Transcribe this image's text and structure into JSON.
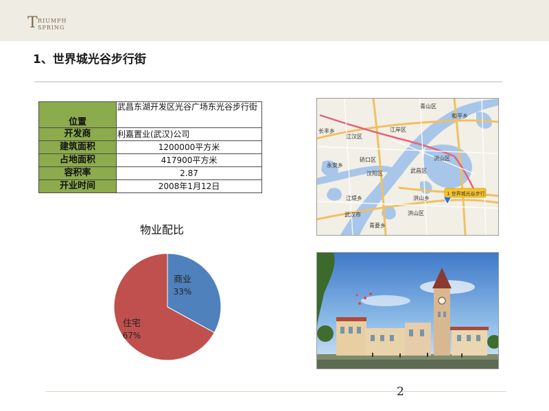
{
  "logo": {
    "letter": "T",
    "line1": "RIUMPH",
    "line2": "SPRING"
  },
  "title": "1、世界城光谷步行街",
  "table": [
    {
      "key": "位置",
      "value": "武昌东湖开发区光谷广场东光谷步行街"
    },
    {
      "key": "开发商",
      "value": "利嘉置业(武汉)公司"
    },
    {
      "key": "建筑面积",
      "value": "1200000平方米"
    },
    {
      "key": "占地面积",
      "value": "417900平方米"
    },
    {
      "key": "容积率",
      "value": "2.87"
    },
    {
      "key": "开业时间",
      "value": "2008年1月12日"
    }
  ],
  "map": {
    "labels": [
      "青山区",
      "和平乡",
      "长丰乡",
      "江汉区",
      "江岸区",
      "硚口区",
      "汉阳区",
      "武昌区",
      "洪山区",
      "洪山乡",
      "永安乡",
      "江堤乡",
      "青菱乡",
      "武汉市",
      "洪山区",
      "1 世界城光谷步行"
    ]
  },
  "page_number": "2",
  "chart_data": {
    "type": "pie",
    "title": "物业配比",
    "categories": [
      "商业",
      "住宅"
    ],
    "values": [
      33,
      67
    ],
    "labels": [
      "33%",
      "67%"
    ],
    "colors": [
      "#4f81bd",
      "#c0504d"
    ],
    "legend": "none"
  }
}
